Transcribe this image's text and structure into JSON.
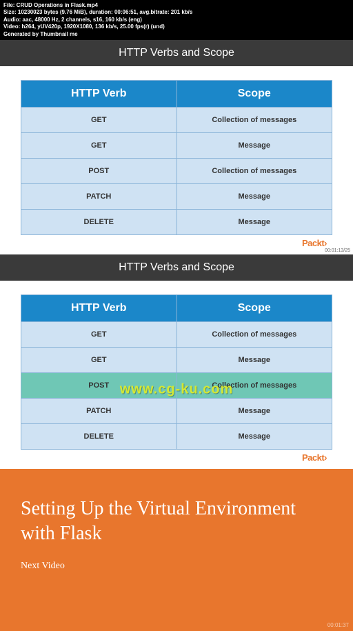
{
  "metadata": {
    "file": "File: CRUD Operations in Flask.mp4",
    "size": "Size: 10230023 bytes (9.76 MiB), duration: 00:06:51, avg.bitrate: 201 kb/s",
    "audio": "Audio: aac, 48000 Hz, 2 channels, s16, 160 kb/s (eng)",
    "video": "Video: h264, yUV420p, 1920X1080, 136 kb/s, 25.00 fps(r) (und)",
    "generated": "Generated by Thumbnail me"
  },
  "slide1": {
    "title": "HTTP Verbs and Scope",
    "headers": [
      "HTTP Verb",
      "Scope"
    ],
    "rows": [
      {
        "verb": "GET",
        "scope": "Collection of messages"
      },
      {
        "verb": "GET",
        "scope": "Message"
      },
      {
        "verb": "POST",
        "scope": "Collection of messages"
      },
      {
        "verb": "PATCH",
        "scope": "Message"
      },
      {
        "verb": "DELETE",
        "scope": "Message"
      }
    ],
    "logo": "Packt",
    "timestamp": "00:01:13/25"
  },
  "slide2": {
    "title": "HTTP Verbs and Scope",
    "headers": [
      "HTTP Verb",
      "Scope"
    ],
    "rows": [
      {
        "verb": "GET",
        "scope": "Collection of messages"
      },
      {
        "verb": "GET",
        "scope": "Message"
      },
      {
        "verb": "POST",
        "scope": "Collection of messages",
        "highlight": true
      },
      {
        "verb": "PATCH",
        "scope": "Message"
      },
      {
        "verb": "DELETE",
        "scope": "Message"
      }
    ],
    "logo": "Packt",
    "watermark": "www.cg-ku.com"
  },
  "slide3": {
    "title": "Setting Up the Virtual Environment with Flask",
    "label": "Next Video",
    "timestamp": "00:01:37"
  }
}
